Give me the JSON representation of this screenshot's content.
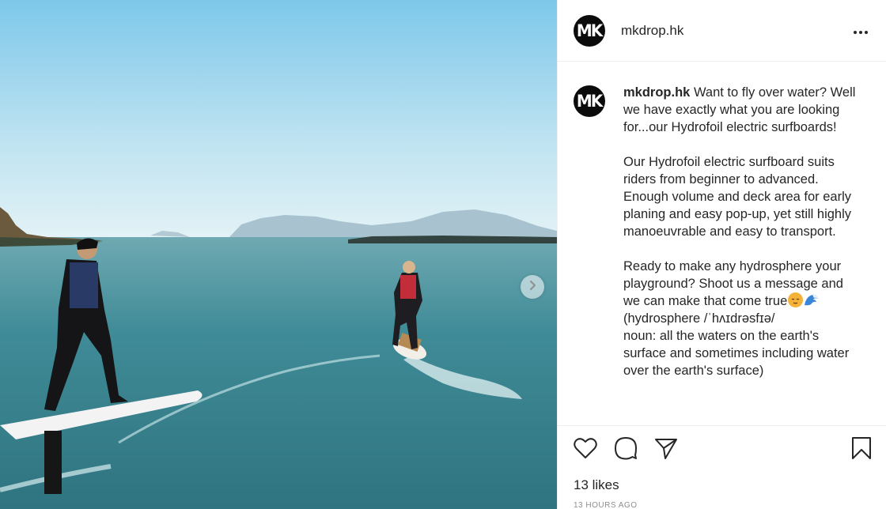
{
  "post": {
    "username": "mkdrop.hk",
    "avatar_text": "MK",
    "caption": {
      "username": "mkdrop.hk",
      "paragraph1": " Want to fly over water? Well we have exactly what you are looking for...our Hydrofoil electric surfboards!",
      "paragraph2": "Our Hydrofoil electric surfboard suits riders from beginner to advanced. Enough volume and deck area for early planing and easy pop-up, yet still highly manoeuvrable and easy to transport.",
      "paragraph3_start": "Ready to make any hydrosphere your playground? Shoot us a message and we can make that come true",
      "paragraph3_end": "(hydrosphere /ˈhʌɪdrəsfɪə/\nnoun: all the waters on the earth's surface and sometimes including water over the earth's surface)"
    },
    "likes": "13 likes",
    "timestamp": "13 HOURS AGO"
  },
  "icons": {
    "more": "more-options-icon",
    "next": "chevron-right-icon",
    "like": "heart-icon",
    "comment": "comment-bubble-icon",
    "share": "paper-plane-icon",
    "save": "bookmark-icon"
  },
  "colors": {
    "text": "#262626",
    "border": "#efefef",
    "muted": "#8e8e8e",
    "avatar_bg": "#0b0b0b"
  }
}
